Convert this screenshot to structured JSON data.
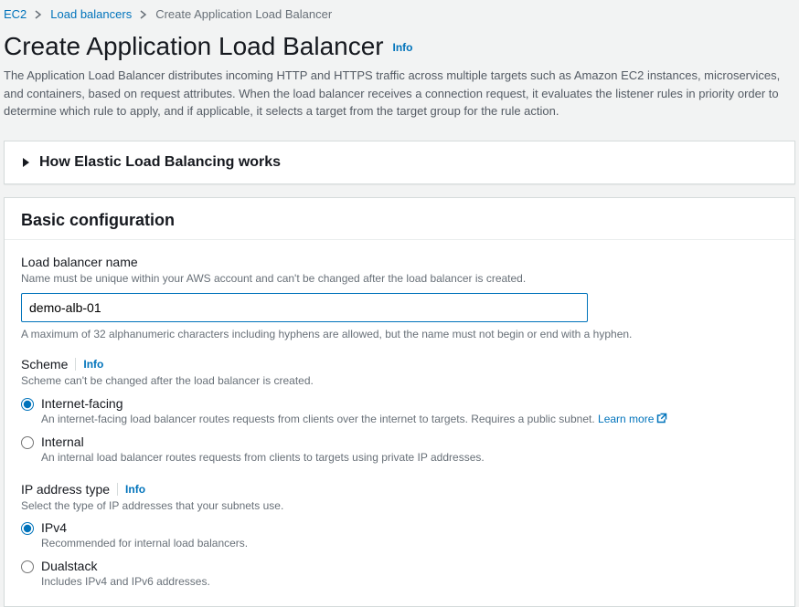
{
  "breadcrumbs": {
    "items": [
      {
        "label": "EC2"
      },
      {
        "label": "Load balancers"
      },
      {
        "label": "Create Application Load Balancer"
      }
    ]
  },
  "header": {
    "title": "Create Application Load Balancer",
    "info": "Info",
    "description": "The Application Load Balancer distributes incoming HTTP and HTTPS traffic across multiple targets such as Amazon EC2 instances, microservices, and containers, based on request attributes. When the load balancer receives a connection request, it evaluates the listener rules in priority order to determine which rule to apply, and if applicable, it selects a target from the target group for the rule action."
  },
  "howItWorks": {
    "title": "How Elastic Load Balancing works"
  },
  "basic": {
    "title": "Basic configuration",
    "name": {
      "label": "Load balancer name",
      "hint": "Name must be unique within your AWS account and can't be changed after the load balancer is created.",
      "value": "demo-alb-01",
      "post": "A maximum of 32 alphanumeric characters including hyphens are allowed, but the name must not begin or end with a hyphen."
    },
    "scheme": {
      "label": "Scheme",
      "info": "Info",
      "hint": "Scheme can't be changed after the load balancer is created.",
      "options": [
        {
          "label": "Internet-facing",
          "desc": "An internet-facing load balancer routes requests from clients over the internet to targets. Requires a public subnet.",
          "learn": "Learn more"
        },
        {
          "label": "Internal",
          "desc": "An internal load balancer routes requests from clients to targets using private IP addresses."
        }
      ]
    },
    "ip": {
      "label": "IP address type",
      "info": "Info",
      "hint": "Select the type of IP addresses that your subnets use.",
      "options": [
        {
          "label": "IPv4",
          "desc": "Recommended for internal load balancers."
        },
        {
          "label": "Dualstack",
          "desc": "Includes IPv4 and IPv6 addresses."
        }
      ]
    }
  }
}
